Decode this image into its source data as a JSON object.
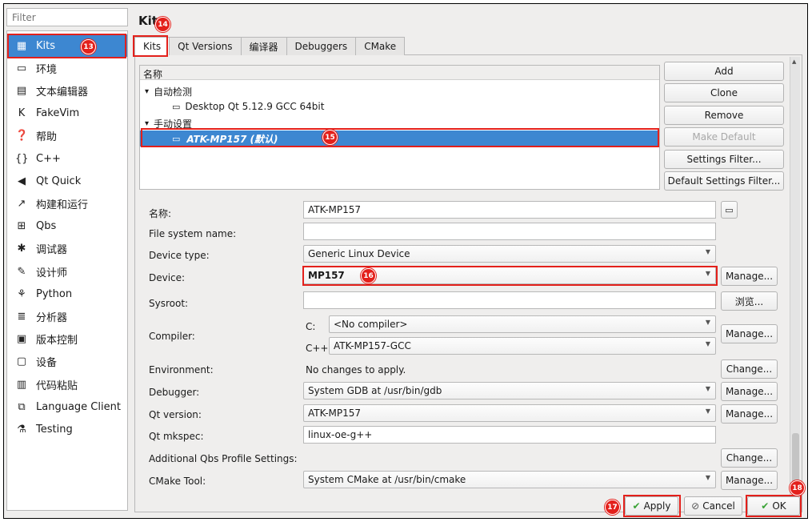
{
  "filter": {
    "placeholder": "Filter"
  },
  "sidebar": {
    "items": [
      {
        "icon": "kits-icon",
        "glyph": "▦",
        "label": "Kits"
      },
      {
        "icon": "monitor-icon",
        "glyph": "▭",
        "label": "环境"
      },
      {
        "icon": "text-editor-icon",
        "glyph": "▤",
        "label": "文本编辑器"
      },
      {
        "icon": "fakevim-icon",
        "glyph": "K",
        "label": "FakeVim"
      },
      {
        "icon": "help-icon",
        "glyph": "❓",
        "label": "帮助"
      },
      {
        "icon": "cpp-icon",
        "glyph": "{}",
        "label": "C++"
      },
      {
        "icon": "qtquick-icon",
        "glyph": "◀",
        "label": "Qt Quick"
      },
      {
        "icon": "build-run-icon",
        "glyph": "↗",
        "label": "构建和运行"
      },
      {
        "icon": "qbs-icon",
        "glyph": "⊞",
        "label": "Qbs"
      },
      {
        "icon": "debugger-icon",
        "glyph": "✱",
        "label": "调试器"
      },
      {
        "icon": "designer-icon",
        "glyph": "✎",
        "label": "设计师"
      },
      {
        "icon": "python-icon",
        "glyph": "⚘",
        "label": "Python"
      },
      {
        "icon": "analyzer-icon",
        "glyph": "≣",
        "label": "分析器"
      },
      {
        "icon": "version-control-icon",
        "glyph": "▣",
        "label": "版本控制"
      },
      {
        "icon": "devices-icon",
        "glyph": "▢",
        "label": "设备"
      },
      {
        "icon": "code-paste-icon",
        "glyph": "▥",
        "label": "代码粘贴"
      },
      {
        "icon": "language-client-icon",
        "glyph": "⧉",
        "label": "Language Client"
      },
      {
        "icon": "testing-icon",
        "glyph": "⚗",
        "label": "Testing"
      }
    ]
  },
  "page": {
    "title": "Kits"
  },
  "tabs": [
    "Kits",
    "Qt Versions",
    "编译器",
    "Debuggers",
    "CMake"
  ],
  "tree": {
    "header": "名称",
    "auto_group": "自动检测",
    "auto_kit": "Desktop Qt 5.12.9 GCC 64bit",
    "manual_group": "手动设置",
    "manual_kit": "ATK-MP157 (默认)",
    "expand_glyph": "▾"
  },
  "kit_buttons": {
    "add": "Add",
    "clone": "Clone",
    "remove": "Remove",
    "make_default": "Make Default",
    "settings_filter": "Settings Filter...",
    "default_settings_filter": "Default Settings Filter..."
  },
  "form": {
    "name_label": "名称:",
    "name_value": "ATK-MP157",
    "fs_label": "File system name:",
    "fs_value": "",
    "device_type_label": "Device type:",
    "device_type_value": "Generic Linux Device",
    "device_label": "Device:",
    "device_value": "MP157",
    "sysroot_label": "Sysroot:",
    "sysroot_value": "",
    "compiler_label": "Compiler:",
    "compiler_c_label": "C:",
    "compiler_c_value": "<No compiler>",
    "compiler_cpp_label": "C++:",
    "compiler_cpp_value": "ATK-MP157-GCC",
    "env_label": "Environment:",
    "env_value": "No changes to apply.",
    "debugger_label": "Debugger:",
    "debugger_value": "System GDB at /usr/bin/gdb",
    "qtver_label": "Qt version:",
    "qtver_value": "ATK-MP157",
    "mkspec_label": "Qt mkspec:",
    "mkspec_value": "linux-oe-g++",
    "qbs_label": "Additional Qbs Profile Settings:",
    "cmake_label": "CMake Tool:",
    "cmake_value": "System CMake at /usr/bin/cmake",
    "manage": "Manage...",
    "browse": "浏览...",
    "change": "Change..."
  },
  "bottom": {
    "apply": "Apply",
    "cancel": "Cancel",
    "ok": "OK"
  },
  "badges": {
    "b13": "13",
    "b14": "14",
    "b15": "15",
    "b16": "16",
    "b17": "17",
    "b18": "18"
  },
  "colors": {
    "selection": "#3d87d1",
    "annotation": "#e3201b",
    "apply_check": "#3aa336"
  }
}
